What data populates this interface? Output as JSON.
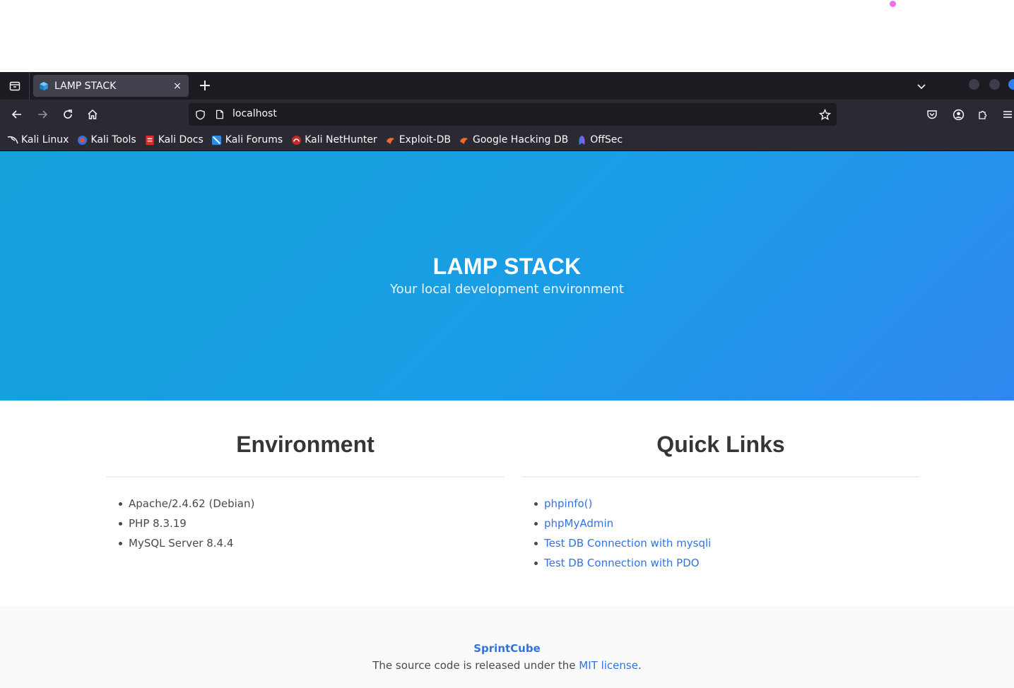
{
  "browser": {
    "tab": {
      "title": "LAMP STACK"
    },
    "new_tab_label": "+",
    "close_tab_label": "×",
    "url": "localhost",
    "bookmarks": [
      {
        "label": "Kali Linux",
        "icon": "kali-dragon-icon"
      },
      {
        "label": "Kali Tools",
        "icon": "kali-tools-icon"
      },
      {
        "label": "Kali Docs",
        "icon": "kali-docs-icon"
      },
      {
        "label": "Kali Forums",
        "icon": "kali-forums-icon"
      },
      {
        "label": "Kali NetHunter",
        "icon": "kali-nethunter-icon"
      },
      {
        "label": "Exploit-DB",
        "icon": "exploit-db-icon"
      },
      {
        "label": "Google Hacking DB",
        "icon": "ghdb-icon"
      },
      {
        "label": "OffSec",
        "icon": "offsec-icon"
      }
    ],
    "colors": {
      "toolbar": "#2b2a33",
      "tabstrip": "#1c1b22",
      "active_tab": "#42414d"
    }
  },
  "hero": {
    "title": "LAMP STACK",
    "subtitle": "Your local development environment",
    "gradient": [
      "#14a1d9",
      "#2f87ef"
    ]
  },
  "environment": {
    "heading": "Environment",
    "items": [
      "Apache/2.4.62 (Debian)",
      "PHP 8.3.19",
      "MySQL Server 8.4.4"
    ]
  },
  "quick_links": {
    "heading": "Quick Links",
    "items": [
      "phpinfo()",
      "phpMyAdmin",
      "Test DB Connection with mysqli",
      "Test DB Connection with PDO"
    ]
  },
  "footer": {
    "brand": "SprintCube",
    "text_before": "The source code is released under the",
    "license_link": "MIT license",
    "text_after": "."
  },
  "link_color": "#3273dc"
}
